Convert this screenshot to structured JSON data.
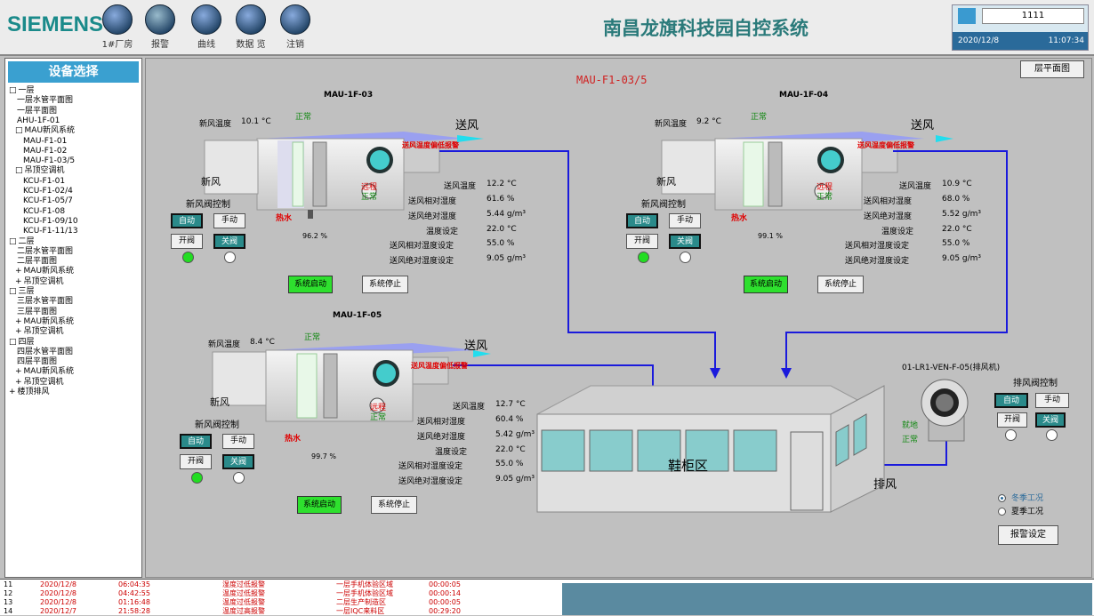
{
  "header": {
    "logo": "SIEMENS",
    "title": "南昌龙旗科技园自控系统",
    "toolbar": [
      {
        "label": "1#厂房",
        "icon": "globe-icon"
      },
      {
        "label": "报警",
        "icon": "warning-icon"
      },
      {
        "label": "曲线",
        "icon": "folder-icon"
      },
      {
        "label": "数据 览",
        "icon": "tools-icon"
      },
      {
        "label": "注销",
        "icon": "folder-open-icon"
      }
    ],
    "user": "1111",
    "date": "2020/12/8",
    "time": "11:07:34"
  },
  "sidebar": {
    "title": "设备选择",
    "items": [
      {
        "label": "一层",
        "mark": "□"
      },
      {
        "label": "一层水管平面图",
        "mark": ""
      },
      {
        "label": "一层平面图",
        "mark": ""
      },
      {
        "label": "AHU-1F-01",
        "mark": ""
      },
      {
        "label": "MAU新风系统",
        "mark": "□"
      },
      {
        "label": "MAU-F1-01",
        "mark": ""
      },
      {
        "label": "MAU-F1-02",
        "mark": ""
      },
      {
        "label": "MAU-F1-03/5",
        "mark": ""
      },
      {
        "label": "吊顶空调机",
        "mark": "□"
      },
      {
        "label": "KCU-F1-01",
        "mark": ""
      },
      {
        "label": "KCU-F1-02/4",
        "mark": ""
      },
      {
        "label": "KCU-F1-05/7",
        "mark": ""
      },
      {
        "label": "KCU-F1-08",
        "mark": ""
      },
      {
        "label": "KCU-F1-09/10",
        "mark": ""
      },
      {
        "label": "KCU-F1-11/13",
        "mark": ""
      },
      {
        "label": "二层",
        "mark": "□"
      },
      {
        "label": "二层水管平面图",
        "mark": ""
      },
      {
        "label": "二层平面图",
        "mark": ""
      },
      {
        "label": "MAU新风系统",
        "mark": "+"
      },
      {
        "label": "吊顶空调机",
        "mark": "+"
      },
      {
        "label": "三层",
        "mark": "□"
      },
      {
        "label": "三层水管平面图",
        "mark": ""
      },
      {
        "label": "三层平面图",
        "mark": ""
      },
      {
        "label": "MAU新风系统",
        "mark": "+"
      },
      {
        "label": "吊顶空调机",
        "mark": "+"
      },
      {
        "label": "四层",
        "mark": "□"
      },
      {
        "label": "四层水管平面图",
        "mark": ""
      },
      {
        "label": "四层平面图",
        "mark": ""
      },
      {
        "label": "MAU新风系统",
        "mark": "+"
      },
      {
        "label": "吊顶空调机",
        "mark": "+"
      },
      {
        "label": "楼顶排风",
        "mark": "+"
      }
    ]
  },
  "main": {
    "page_title": "MAU-F1-03/5",
    "floor_plan_button": "层平面图",
    "room_label": "鞋柜区",
    "exhaust_label": "排风",
    "units": [
      {
        "name": "MAU-1F-03",
        "fresh_air_temp_label": "新风温度",
        "fresh_air_temp": "10.1 °C",
        "status": "正常",
        "supply_air": "送风",
        "fresh_air": "新风",
        "alarm_tag": "送风温度偏低报警",
        "damper_control": "新风阀控制",
        "auto": "自动",
        "manual": "手动",
        "open": "开阀",
        "close": "关阀",
        "hot_water": "热水",
        "valve_pct": "96.2 %",
        "fan_mode": "远程",
        "fan_status": "正常",
        "supply_temp_label": "送风温度",
        "supply_temp": "12.2 °C",
        "supply_rh_label": "送风相对湿度",
        "supply_rh": "61.6 %",
        "supply_ah_label": "送风绝对湿度",
        "supply_ah": "5.44 g/m³",
        "temp_set_label": "温度设定",
        "temp_set": "22.0 °C",
        "rh_set_label": "送风相对湿度设定",
        "rh_set": "55.0 %",
        "ah_set_label": "送风绝对湿度设定",
        "ah_set": "9.05 g/m³",
        "start_button": "系统启动",
        "stop_button": "系统停止"
      },
      {
        "name": "MAU-1F-04",
        "fresh_air_temp_label": "新风温度",
        "fresh_air_temp": "9.2 °C",
        "status": "正常",
        "supply_air": "送风",
        "fresh_air": "新风",
        "alarm_tag": "送风温度偏低报警",
        "damper_control": "新风阀控制",
        "auto": "自动",
        "manual": "手动",
        "open": "开阀",
        "close": "关阀",
        "hot_water": "热水",
        "valve_pct": "99.1 %",
        "fan_mode": "远程",
        "fan_status": "正常",
        "supply_temp_label": "送风温度",
        "supply_temp": "10.9 °C",
        "supply_rh_label": "送风相对湿度",
        "supply_rh": "68.0 %",
        "supply_ah_label": "送风绝对湿度",
        "supply_ah": "5.52 g/m³",
        "temp_set_label": "温度设定",
        "temp_set": "22.0 °C",
        "rh_set_label": "送风相对湿度设定",
        "rh_set": "55.0 %",
        "ah_set_label": "送风绝对湿度设定",
        "ah_set": "9.05 g/m³",
        "start_button": "系统启动",
        "stop_button": "系统停止"
      },
      {
        "name": "MAU-1F-05",
        "fresh_air_temp_label": "新风温度",
        "fresh_air_temp": "8.4 °C",
        "status": "正常",
        "supply_air": "送风",
        "fresh_air": "新风",
        "alarm_tag": "送风温度偏低报警",
        "damper_control": "新风阀控制",
        "auto": "自动",
        "manual": "手动",
        "open": "开阀",
        "close": "关阀",
        "hot_water": "热水",
        "valve_pct": "99.7 %",
        "fan_mode": "远程",
        "fan_status": "正常",
        "supply_temp_label": "送风温度",
        "supply_temp": "12.7 °C",
        "supply_rh_label": "送风相对湿度",
        "supply_rh": "60.4 %",
        "supply_ah_label": "送风绝对湿度",
        "supply_ah": "5.42 g/m³",
        "temp_set_label": "温度设定",
        "temp_set": "22.0 °C",
        "rh_set_label": "送风相对湿度设定",
        "rh_set": "55.0 %",
        "ah_set_label": "送风绝对湿度设定",
        "ah_set": "9.05 g/m³",
        "start_button": "系统启动",
        "stop_button": "系统停止"
      }
    ],
    "exhaust_fan": {
      "name": "01-LR1-VEN-F-05(排风机)",
      "control": "排风阀控制",
      "mode": "就地",
      "status": "正常",
      "auto": "自动",
      "manual": "手动",
      "open": "开阀",
      "close": "关阀"
    },
    "season": {
      "winter": "冬季工况",
      "summer": "夏季工况",
      "selected": "winter"
    },
    "alarm_settings_button": "报警设定"
  },
  "alarms": [
    {
      "no": "11",
      "date": "2020/12/8",
      "time": "06:04:35",
      "type": "湿度过低报警",
      "location": "一层手机体验区域",
      "duration": "00:00:05"
    },
    {
      "no": "12",
      "date": "2020/12/8",
      "time": "04:42:55",
      "type": "温度过低报警",
      "location": "一层手机体验区域",
      "duration": "00:00:14"
    },
    {
      "no": "13",
      "date": "2020/12/8",
      "time": "01:16:48",
      "type": "温度过低报警",
      "location": "二层生产制造区",
      "duration": "00:00:05"
    },
    {
      "no": "14",
      "date": "2020/12/7",
      "time": "21:58:28",
      "type": "温度过高报警",
      "location": "一层IQC来料区",
      "duration": "00:29:20"
    }
  ],
  "colors": {
    "accent": "#1a8a8a",
    "alarm_red": "#cc0000",
    "duct_blue": "#1a1adc",
    "start_green": "#2ee02e"
  }
}
